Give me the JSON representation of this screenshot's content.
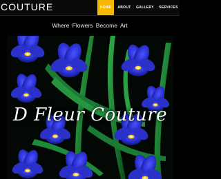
{
  "header": {
    "brand": "COUTURE",
    "nav": [
      {
        "label": "HOME",
        "active": true
      },
      {
        "label": "ABOUT",
        "active": false
      },
      {
        "label": "GALLERY",
        "active": false
      },
      {
        "label": "SERVICES",
        "active": false
      }
    ]
  },
  "tagline": "Where Flowers Become Art",
  "hero": {
    "title": "D Fleur Couture",
    "image": "blue-iris-flowers"
  },
  "colors": {
    "accent": "#f6b800",
    "background": "#000000",
    "iris_blue": "#2a2fd0",
    "stem_green": "#1f8a3a"
  }
}
